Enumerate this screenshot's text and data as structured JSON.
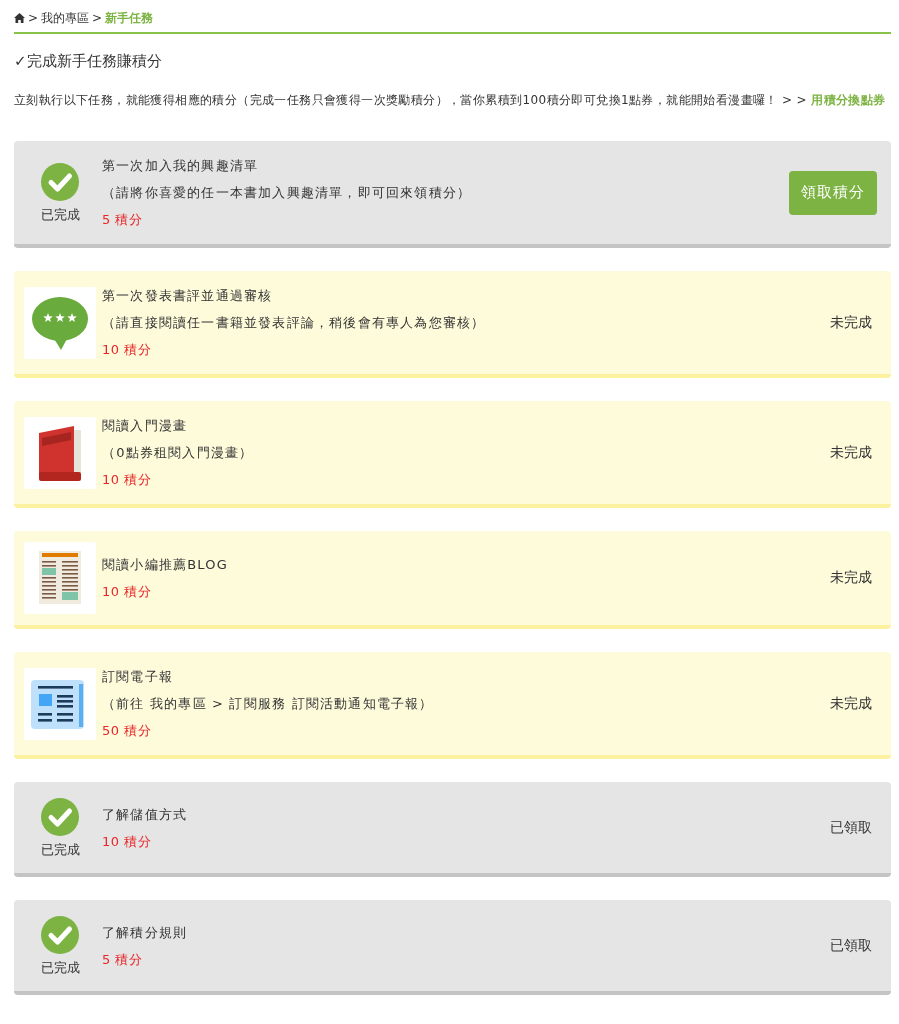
{
  "breadcrumb": {
    "items": [
      {
        "separator": ">",
        "label": "我的專區",
        "selected": false
      },
      {
        "separator": ">",
        "label": "新手任務",
        "selected": true
      }
    ]
  },
  "title": "✓完成新手任務賺積分",
  "intro": {
    "text": "立刻執行以下任務，就能獲得相應的積分（完成一任務只會獲得一次獎勵積分），當你累積到100積分即可兌換1點券，就能開始看漫畫囉！ > >",
    "link": "用積分換點券"
  },
  "tasks": [
    {
      "completed": true,
      "done_label": "已完成",
      "title": "第一次加入我的興趣清單",
      "note": "（請將你喜愛的任一本書加入興趣清單，即可回來領積分）",
      "points": "5 積分",
      "action": {
        "kind": "button",
        "label": "領取積分"
      }
    },
    {
      "completed": false,
      "kind": "bubble",
      "title": "第一次發表書評並通過審核",
      "note": "（請直接閱讀任一書籍並發表評論，稍後會有專人為您審核）",
      "points": "10 積分",
      "action": {
        "kind": "status",
        "label": "未完成"
      }
    },
    {
      "completed": false,
      "kind": "book",
      "title": "閱讀入門漫畫",
      "note": "（0點券租閱入門漫畫）",
      "points": "10 積分",
      "action": {
        "kind": "status",
        "label": "未完成"
      }
    },
    {
      "completed": false,
      "kind": "article",
      "title": "閱讀小編推薦BLOG",
      "points": "10 積分",
      "action": {
        "kind": "status",
        "label": "未完成"
      }
    },
    {
      "completed": false,
      "kind": "newspaper",
      "title": "訂閱電子報",
      "note": "（前往 我的專區 > 訂閱服務 訂閱活動通知電子報）",
      "points": "50 積分",
      "action": {
        "kind": "status",
        "label": "未完成"
      }
    },
    {
      "completed": true,
      "done_label": "已完成",
      "title": "了解儲值方式",
      "points": "10 積分",
      "action": {
        "kind": "status",
        "label": "已領取"
      }
    },
    {
      "completed": true,
      "done_label": "已完成",
      "title": "了解積分規則",
      "points": "5 積分",
      "action": {
        "kind": "status",
        "label": "已領取"
      }
    }
  ]
}
